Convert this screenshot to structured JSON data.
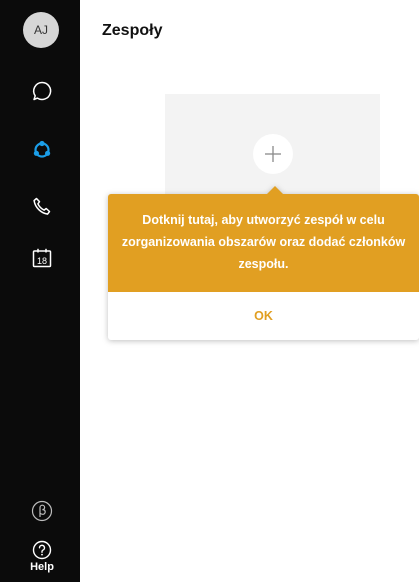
{
  "user": {
    "initials": "AJ"
  },
  "sidebar": {
    "calendar_day": "18",
    "help_label": "Help",
    "icons": [
      "chat-icon",
      "teams-icon",
      "phone-icon",
      "calendar-icon",
      "beta-icon",
      "help-icon"
    ],
    "active_color": "#1b9ee8"
  },
  "header": {
    "title": "Zespoły"
  },
  "tooltip": {
    "message": "Dotknij tutaj, aby utworzyć zespół w celu zorganizowania obszarów oraz dodać członków zespołu.",
    "ok_label": "OK",
    "accent_color": "#e19f22"
  }
}
